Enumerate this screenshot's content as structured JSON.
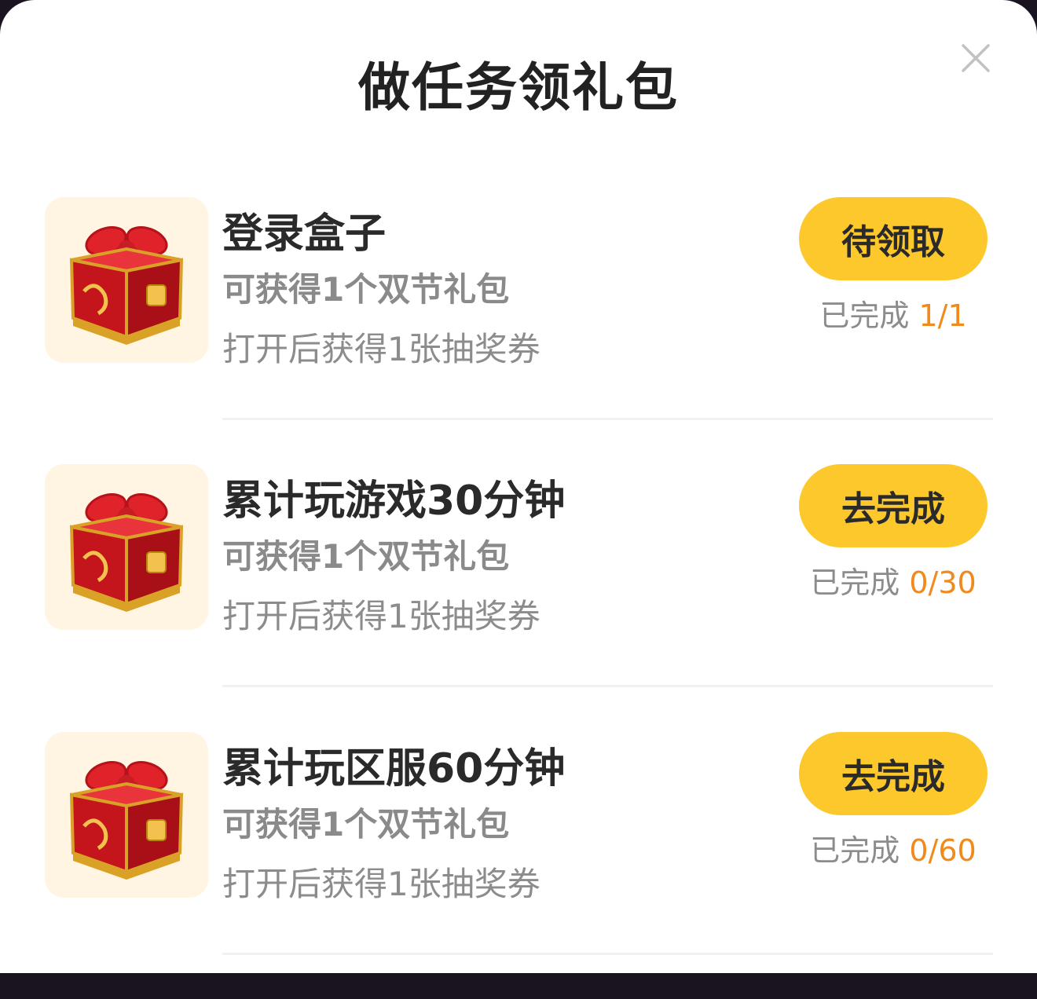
{
  "modal": {
    "title": "做任务领礼包",
    "close_icon": "close-icon"
  },
  "colors": {
    "button": "#fdc82b",
    "progress_number": "#f08a1c",
    "thumb_bg": "#fff5e2"
  },
  "tasks": [
    {
      "name": "登录盒子",
      "reward": "可获得1个双节礼包",
      "desc": "打开后获得1张抽奖券",
      "button": "待领取",
      "progress_label": "已完成",
      "progress_value": "1/1",
      "icon": "gift-box-icon"
    },
    {
      "name": "累计玩游戏30分钟",
      "reward": "可获得1个双节礼包",
      "desc": "打开后获得1张抽奖券",
      "button": "去完成",
      "progress_label": "已完成",
      "progress_value": "0/30",
      "icon": "gift-box-icon"
    },
    {
      "name": "累计玩区服60分钟",
      "reward": "可获得1个双节礼包",
      "desc": "打开后获得1张抽奖券",
      "button": "去完成",
      "progress_label": "已完成",
      "progress_value": "0/60",
      "icon": "gift-box-icon"
    }
  ]
}
